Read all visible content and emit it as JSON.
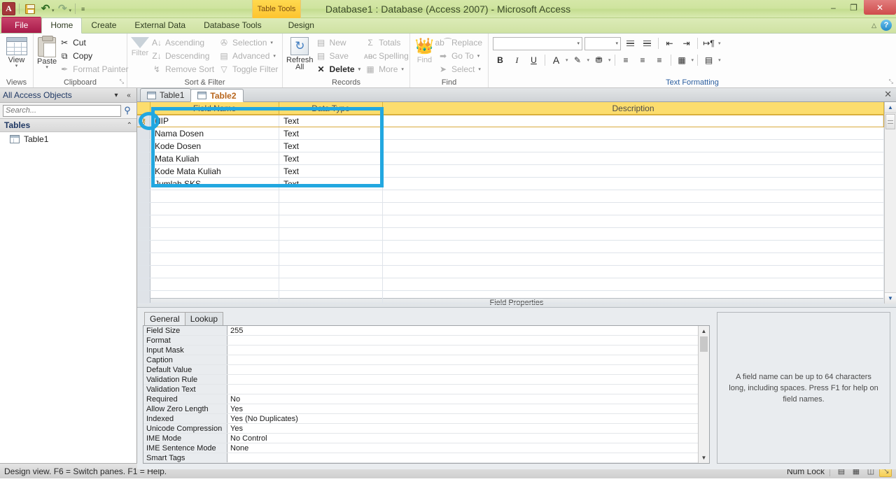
{
  "window": {
    "title": "Database1 : Database (Access 2007)  -  Microsoft Access",
    "tool_context_label": "Table Tools",
    "app_logo_letter": "A",
    "minimize": "–",
    "restore": "❐",
    "close": "✕",
    "help_label": "?",
    "collapse_ribbon": "△"
  },
  "quick_access": {
    "save": "save-icon",
    "undo": "↶",
    "redo": "↷",
    "customize": "≡"
  },
  "ribbon_tabs": [
    {
      "label": "File",
      "kind": "file"
    },
    {
      "label": "Home",
      "kind": "active"
    },
    {
      "label": "Create",
      "kind": "normal"
    },
    {
      "label": "External Data",
      "kind": "normal"
    },
    {
      "label": "Database Tools",
      "kind": "normal"
    },
    {
      "label": "Design",
      "kind": "contextual"
    }
  ],
  "ribbon_groups": {
    "views": {
      "title": "Views",
      "button": {
        "label": "View",
        "caret": "▾",
        "icon": "datasheet-grid-icon"
      }
    },
    "clipboard": {
      "title": "Clipboard",
      "paste": {
        "label": "Paste",
        "caret": "▾"
      },
      "commands": [
        {
          "label": "Cut",
          "icon": "✂",
          "dim": false
        },
        {
          "label": "Copy",
          "icon": "⧉",
          "dim": false
        },
        {
          "label": "Format Painter",
          "icon": "✒",
          "dim": false
        }
      ],
      "dialog_launcher": "⤡"
    },
    "sort_filter": {
      "title": "Sort & Filter",
      "filter": {
        "label": "Filter"
      },
      "col1": [
        {
          "label": "Ascending",
          "icon": "A↓"
        },
        {
          "label": "Descending",
          "icon": "Z↓"
        },
        {
          "label": "Remove Sort",
          "icon": "↯"
        }
      ],
      "col2": [
        {
          "label": "Selection",
          "icon": "✇",
          "caret": "▾"
        },
        {
          "label": "Advanced",
          "icon": "▤",
          "caret": "▾"
        },
        {
          "label": "Toggle Filter",
          "icon": "▽",
          "caret": ""
        }
      ]
    },
    "records": {
      "title": "Records",
      "refresh": {
        "label1": "Refresh",
        "label2": "All",
        "caret": "▾"
      },
      "col1": [
        {
          "label": "New",
          "icon": "▤"
        },
        {
          "label": "Save",
          "icon": "▤"
        },
        {
          "label": "Delete",
          "icon": "✕",
          "caret": "▾",
          "bold": true
        }
      ],
      "col2": [
        {
          "label": "Totals",
          "icon": "Σ"
        },
        {
          "label": "Spelling",
          "icon": "ᴀᴃᴄ"
        },
        {
          "label": "More",
          "icon": "▦",
          "caret": "▾"
        }
      ]
    },
    "find": {
      "title": "Find",
      "find_button": {
        "label": "Find"
      },
      "commands": [
        {
          "label": "Replace",
          "icon": "ab⁀"
        },
        {
          "label": "Go To",
          "icon": "➡",
          "caret": "▾"
        },
        {
          "label": "Select",
          "icon": "➤",
          "caret": "▾"
        }
      ]
    },
    "text_formatting": {
      "title": "Text Formatting",
      "font_family_value": "",
      "font_size_value": "",
      "dialog_launcher": "⤡",
      "buttons_row1": [
        "bulleted-list",
        "numbered-list",
        "decrease-indent",
        "increase-indent",
        "text-direction"
      ],
      "buttons_row2": [
        "bold",
        "italic",
        "underline",
        "font-color",
        "text-highlight",
        "background-color",
        "align-left",
        "align-center",
        "align-right",
        "gridlines",
        "alternate-row-color"
      ],
      "bold": "B",
      "italic": "I",
      "underline": "U",
      "font_color": "A",
      "highlight": "✎",
      "fill": "⛃",
      "align_left": "≡",
      "align_center": "≡",
      "align_right": "≡",
      "gridlines": "▦",
      "alt_row": "▤",
      "caret": "▾"
    }
  },
  "nav_pane": {
    "header_title": "All Access Objects",
    "header_menu_icon": "▾",
    "header_collapse_icon": "«",
    "search_placeholder": "Search...",
    "search_value": "",
    "search_icon": "⚲",
    "group_label": "Tables",
    "group_chevron": "⌃",
    "items": [
      {
        "label": "Table1",
        "icon": "table-icon"
      }
    ]
  },
  "doc_tabs": {
    "tabs": [
      {
        "label": "Table1",
        "active": false
      },
      {
        "label": "Table2",
        "active": true
      }
    ],
    "close_label": "✕"
  },
  "design_grid": {
    "columns": [
      "Field Name",
      "Data Type",
      "Description"
    ],
    "rows": [
      {
        "field_name": "NIP",
        "data_type": "Text",
        "description": "",
        "primary_key": true,
        "current": true
      },
      {
        "field_name": "Nama Dosen",
        "data_type": "Text",
        "description": "",
        "primary_key": false,
        "current": false
      },
      {
        "field_name": "Kode Dosen",
        "data_type": "Text",
        "description": "",
        "primary_key": false,
        "current": false
      },
      {
        "field_name": "Mata Kuliah",
        "data_type": "Text",
        "description": "",
        "primary_key": false,
        "current": false
      },
      {
        "field_name": "Kode Mata Kuliah",
        "data_type": "Text",
        "description": "",
        "primary_key": false,
        "current": false
      },
      {
        "field_name": "Jumlah SKS",
        "data_type": "Text",
        "description": "",
        "primary_key": false,
        "current": false
      }
    ],
    "empty_row_count": 8,
    "key_icon": "⚷",
    "scroll_up": "▲",
    "scroll_down": "▼"
  },
  "field_properties": {
    "bar_title": "Field Properties",
    "tabs": [
      {
        "label": "General",
        "active": true
      },
      {
        "label": "Lookup",
        "active": false
      }
    ],
    "rows": [
      {
        "name": "Field Size",
        "value": "255"
      },
      {
        "name": "Format",
        "value": ""
      },
      {
        "name": "Input Mask",
        "value": ""
      },
      {
        "name": "Caption",
        "value": ""
      },
      {
        "name": "Default Value",
        "value": ""
      },
      {
        "name": "Validation Rule",
        "value": ""
      },
      {
        "name": "Validation Text",
        "value": ""
      },
      {
        "name": "Required",
        "value": "No"
      },
      {
        "name": "Allow Zero Length",
        "value": "Yes"
      },
      {
        "name": "Indexed",
        "value": "Yes (No Duplicates)"
      },
      {
        "name": "Unicode Compression",
        "value": "Yes"
      },
      {
        "name": "IME Mode",
        "value": "No Control"
      },
      {
        "name": "IME Sentence Mode",
        "value": "None"
      },
      {
        "name": "Smart Tags",
        "value": ""
      }
    ],
    "help_text": "A field name can be up to 64 characters long, including spaces. Press F1 for help on field names.",
    "scroll_up": "▲",
    "scroll_down": "▼"
  },
  "status_bar": {
    "message": "Design view.  F6 = Switch panes.  F1 = Help.",
    "num_lock": "Num Lock",
    "view_buttons": [
      {
        "name": "datasheet-view",
        "glyph": "▤",
        "selected": false
      },
      {
        "name": "pivottable-view",
        "glyph": "▦",
        "selected": false
      },
      {
        "name": "pivotchart-view",
        "glyph": "◫",
        "selected": false
      },
      {
        "name": "design-view",
        "glyph": "⤡",
        "selected": true
      }
    ]
  },
  "annotations": {
    "accent_color": "#22a7e0",
    "shapes": [
      {
        "type": "rectangle",
        "name": "field-list-highlight"
      },
      {
        "type": "ellipse",
        "name": "primary-key-highlight"
      }
    ]
  }
}
